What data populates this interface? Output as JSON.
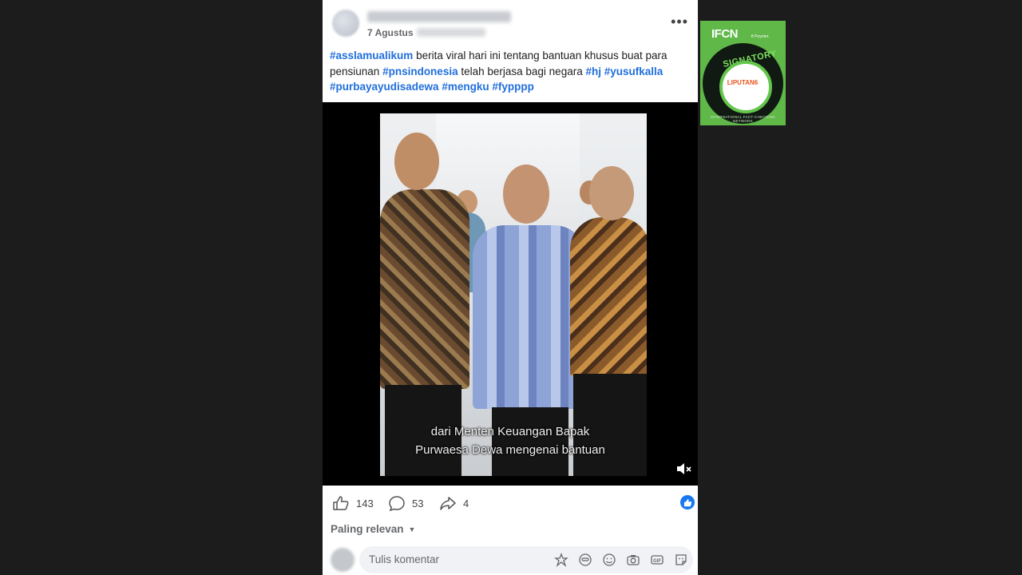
{
  "post": {
    "date": "7 Agustus",
    "caption": [
      {
        "text": "#asslamualikum",
        "tag": true
      },
      {
        "text": " berita viral hari ini tentang bantuan khusus buat para pensiunan ",
        "tag": false
      },
      {
        "text": "#pnsindonesia",
        "tag": true
      },
      {
        "text": " telah berjasa bagi negara ",
        "tag": false
      },
      {
        "text": "#hj",
        "tag": true
      },
      {
        "text": " ",
        "tag": false
      },
      {
        "text": "#yusufkalla",
        "tag": true
      },
      {
        "text": " ",
        "tag": false
      },
      {
        "text": "#purbayayudisadewa",
        "tag": true
      },
      {
        "text": " ",
        "tag": false
      },
      {
        "text": "#mengku",
        "tag": true
      },
      {
        "text": " ",
        "tag": false
      },
      {
        "text": "#fypppp",
        "tag": true
      }
    ],
    "video": {
      "subtitle_line1": "dari Menten Keuangan Bapak",
      "subtitle_line2": "Purwaesa Dewa mengenai bantuan"
    },
    "stats": {
      "likes": "143",
      "comments": "53",
      "shares": "4"
    },
    "sort_label": "Paling relevan",
    "comment_placeholder": "Tulis komentar"
  },
  "ifcn": {
    "logo": "IFCN",
    "sub": "ft Poynter.",
    "badge": "SIGNATORY",
    "org": "LIPUTAN6",
    "ring": "INTERNATIONAL FACT-CHECKING NETWORK"
  },
  "colors": {
    "hashtag": "#216fdb",
    "facebook_blue": "#1877f2",
    "ifcn_green": "#5fb848"
  }
}
